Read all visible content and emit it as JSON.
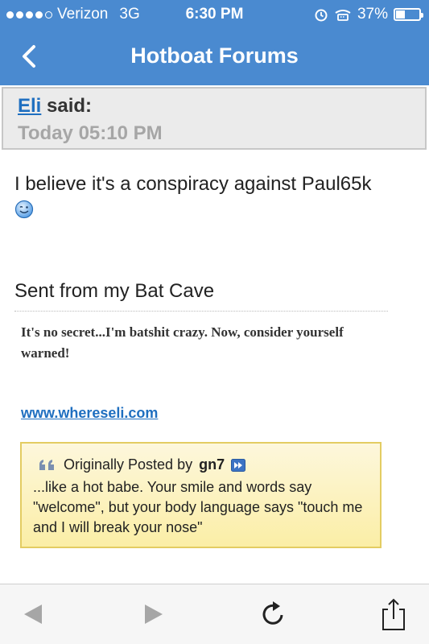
{
  "status": {
    "carrier": "Verizon",
    "network": "3G",
    "time": "6:30 PM",
    "battery": "37%",
    "battery_level": 0.37,
    "signal_bars": 4
  },
  "nav": {
    "title": "Hotboat Forums",
    "back_icon": "chevron-left-icon"
  },
  "post": {
    "author": "Eli",
    "said": " said:",
    "timestamp": "Today 05:10 PM",
    "message": "I believe it's a conspiracy against Paul65k",
    "sent_from": "Sent from my Bat Cave",
    "signature": "It's no secret...I'm batshit crazy. Now, consider yourself warned!",
    "link": "www.whereseli.com"
  },
  "quote": {
    "prefix": "Originally Posted by",
    "author": "gn7",
    "text": "...like a hot babe. Your smile and words say \"welcome\", but your body language says \"touch me and I will break your nose\""
  },
  "toolbar": {
    "icons": [
      "back-arrow-icon",
      "forward-arrow-icon",
      "reload-icon",
      "share-icon"
    ]
  },
  "colors": {
    "nav_bg": "#4a8ad0",
    "link": "#1f6fc0",
    "quote_border": "#e3cc62",
    "quote_bg": "#fbeea6"
  }
}
